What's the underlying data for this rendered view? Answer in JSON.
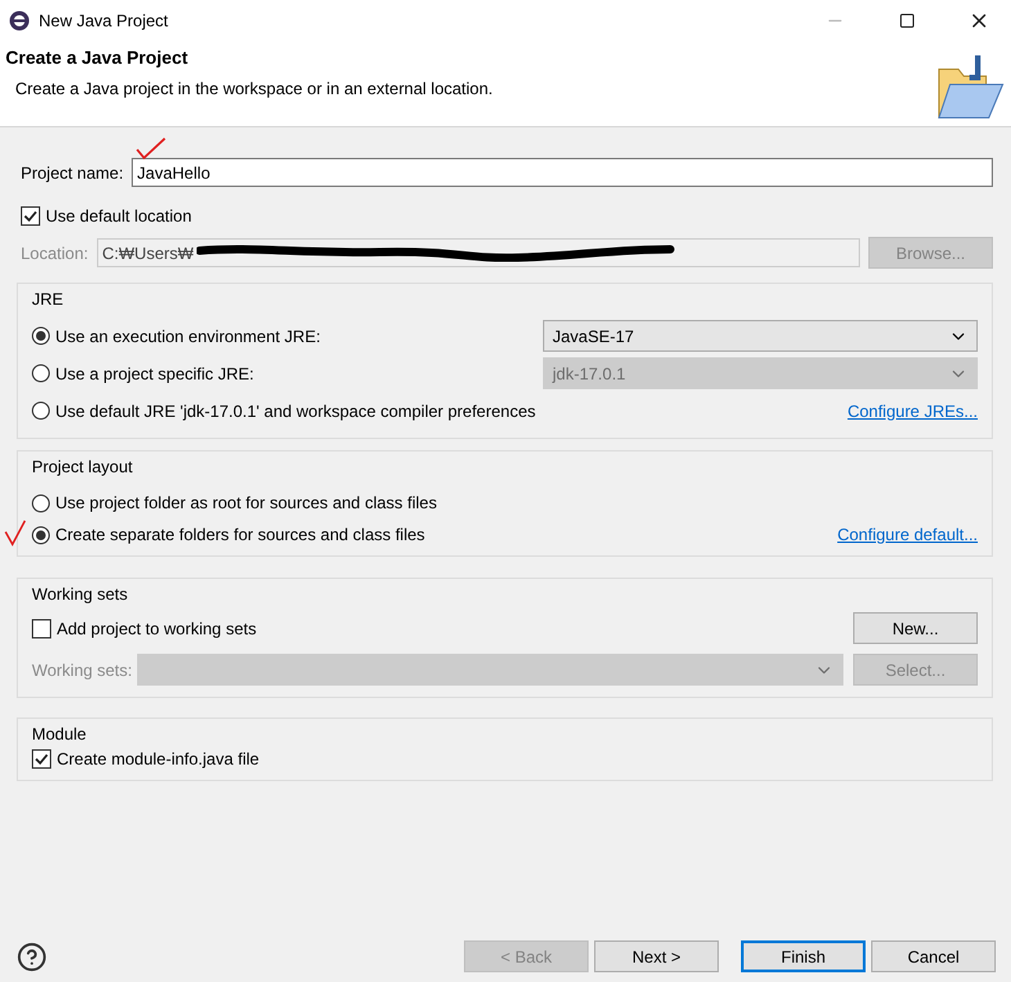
{
  "window": {
    "title": "New Java Project"
  },
  "header": {
    "title": "Create a Java Project",
    "description": "Create a Java project in the workspace or in an external location."
  },
  "project_name": {
    "label": "Project name:",
    "value": "JavaHello"
  },
  "default_location": {
    "label": "Use default location",
    "checked": true
  },
  "location": {
    "label": "Location:",
    "value": "C:₩Users₩",
    "disabled": true,
    "browse": {
      "label": "Browse...",
      "disabled": true
    }
  },
  "jre": {
    "title": "JRE",
    "options": [
      {
        "kind": "select",
        "label": "Use an execution environment JRE:",
        "selected": true,
        "value": "JavaSE-17",
        "disabled": false
      },
      {
        "kind": "select",
        "label": "Use a project specific JRE:",
        "selected": false,
        "value": "jdk-17.0.1",
        "disabled": true
      },
      {
        "kind": "link",
        "label": "Use default JRE 'jdk-17.0.1' and workspace compiler preferences",
        "selected": false,
        "link": "Configure JREs..."
      }
    ]
  },
  "layout": {
    "title": "Project layout",
    "options": [
      {
        "label": "Use project folder as root for sources and class files",
        "selected": false
      },
      {
        "label": "Create separate folders for sources and class files",
        "selected": true
      }
    ],
    "link": "Configure default..."
  },
  "working_sets": {
    "title": "Working sets",
    "checkbox": {
      "label": "Add project to working sets",
      "checked": false
    },
    "new_button": "New...",
    "sets": {
      "label": "Working sets:",
      "disabled": true,
      "button": "Select..."
    }
  },
  "module": {
    "title": "Module",
    "checkbox": {
      "label": "Create module-info.java file",
      "checked": true
    }
  },
  "footer": {
    "buttons": [
      {
        "label": "< Back",
        "disabled": true,
        "primary": false
      },
      {
        "label": "Next >",
        "disabled": false,
        "primary": false
      },
      {
        "label": "Finish",
        "disabled": false,
        "primary": true
      },
      {
        "label": "Cancel",
        "disabled": false,
        "primary": false
      }
    ]
  }
}
